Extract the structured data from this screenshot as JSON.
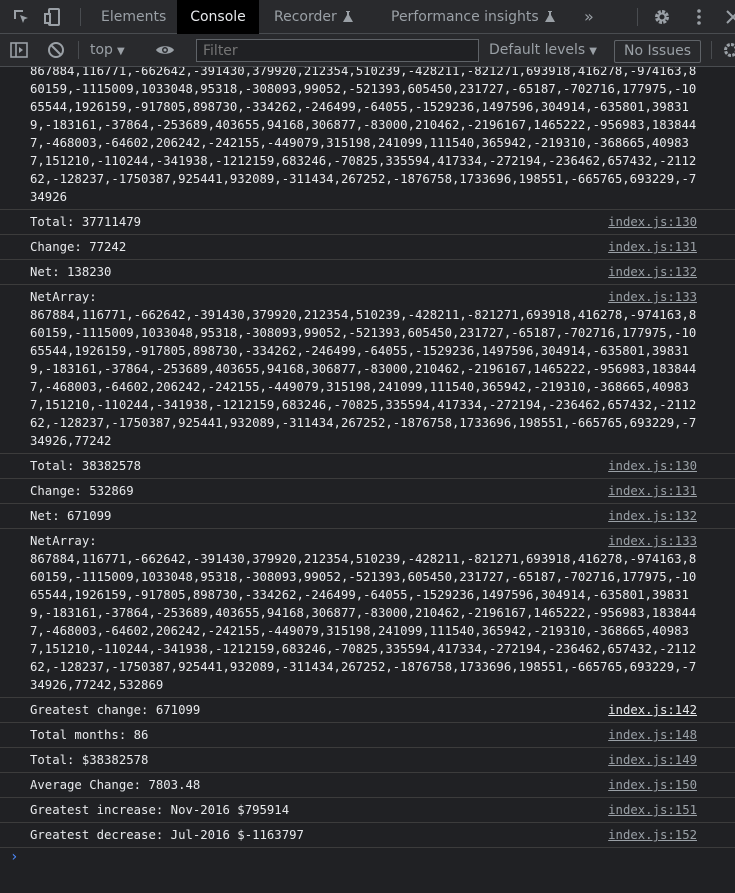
{
  "tabs": {
    "elements": "Elements",
    "console": "Console",
    "recorder": "Recorder",
    "performance": "Performance insights",
    "more": "»"
  },
  "toolbar": {
    "context": "top",
    "filter_placeholder": "Filter",
    "levels": "Default levels",
    "issues": "No Issues"
  },
  "colors": {
    "background": "#202124",
    "prompt": "#4d8bff"
  },
  "console": {
    "messages": [
      {
        "text": "867884,116771,-662642,-391430,379920,212354,510239,-428211,-821271,693918,416278,-974163,860159,-1115009,1033048,95318,-308093,99052,-521393,605450,231727,-65187,-702716,177975,-1065544,1926159,-917805,898730,-334262,-246499,-64055,-1529236,1497596,304914,-635801,398319,-183161,-37864,-253689,403655,94168,306877,-83000,210462,-2196167,1465222,-956983,1838447,-468003,-64602,206242,-242155,-449079,315198,241099,111540,365942,-219310,-368665,409837,151210,-110244,-341938,-1212159,683246,-70825,335594,417334,-272194,-236462,657432,-211262,-128237,-1750387,925441,932089,-311434,267252,-1876758,1733696,198551,-665765,693229,-734926",
        "src": ""
      },
      {
        "text": "Total: 37711479",
        "src": "index.js:130"
      },
      {
        "text": "Change: 77242",
        "src": "index.js:131"
      },
      {
        "text": "Net: 138230",
        "src": "index.js:132"
      },
      {
        "text": "NetArray:\n867884,116771,-662642,-391430,379920,212354,510239,-428211,-821271,693918,416278,-974163,860159,-1115009,1033048,95318,-308093,99052,-521393,605450,231727,-65187,-702716,177975,-1065544,1926159,-917805,898730,-334262,-246499,-64055,-1529236,1497596,304914,-635801,398319,-183161,-37864,-253689,403655,94168,306877,-83000,210462,-2196167,1465222,-956983,1838447,-468003,-64602,206242,-242155,-449079,315198,241099,111540,365942,-219310,-368665,409837,151210,-110244,-341938,-1212159,683246,-70825,335594,417334,-272194,-236462,657432,-211262,-128237,-1750387,925441,932089,-311434,267252,-1876758,1733696,198551,-665765,693229,-734926,77242",
        "src": "index.js:133"
      },
      {
        "text": "Total: 38382578",
        "src": "index.js:130"
      },
      {
        "text": "Change: 532869",
        "src": "index.js:131"
      },
      {
        "text": "Net: 671099",
        "src": "index.js:132"
      },
      {
        "text": "NetArray:\n867884,116771,-662642,-391430,379920,212354,510239,-428211,-821271,693918,416278,-974163,860159,-1115009,1033048,95318,-308093,99052,-521393,605450,231727,-65187,-702716,177975,-1065544,1926159,-917805,898730,-334262,-246499,-64055,-1529236,1497596,304914,-635801,398319,-183161,-37864,-253689,403655,94168,306877,-83000,210462,-2196167,1465222,-956983,1838447,-468003,-64602,206242,-242155,-449079,315198,241099,111540,365942,-219310,-368665,409837,151210,-110244,-341938,-1212159,683246,-70825,335594,417334,-272194,-236462,657432,-211262,-128237,-1750387,925441,932089,-311434,267252,-1876758,1733696,198551,-665765,693229,-734926,77242,532869",
        "src": "index.js:133"
      },
      {
        "text": "Greatest change: 671099",
        "src": "index.js:142"
      },
      {
        "text": "Total months: 86",
        "src": "index.js:148"
      },
      {
        "text": "Total: $38382578",
        "src": "index.js:149"
      },
      {
        "text": "Average Change: 7803.48",
        "src": "index.js:150"
      },
      {
        "text": "Greatest increase: Nov-2016 $795914",
        "src": "index.js:151"
      },
      {
        "text": "Greatest decrease: Jul-2016 $-1163797",
        "src": "index.js:152"
      }
    ],
    "prompt": "›"
  }
}
